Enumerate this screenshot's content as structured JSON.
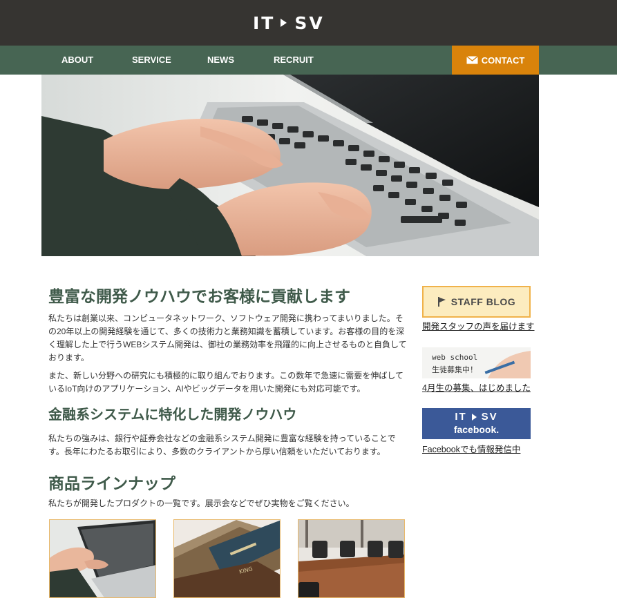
{
  "header": {
    "logo_left": "IT",
    "logo_right": "SV"
  },
  "nav": {
    "items": [
      {
        "label": "ABOUT"
      },
      {
        "label": "SERVICE"
      },
      {
        "label": "NEWS"
      },
      {
        "label": "RECRUIT"
      }
    ],
    "contact_label": "CONTACT"
  },
  "main": {
    "heading1": "豊富な開発ノウハウでお客様に貢献します",
    "para1": "私たちは創業以来、コンピュータネットワーク、ソフトウェア開発に携わってまいりました。その20年以上の開発経験を通じて、多くの技術力と業務知識を蓄積しています。お客様の目的を深く理解した上で行うWEBシステム開発は、御社の業務効率を飛躍的に向上させるものと自負しております。",
    "para2": "また、新しい分野への研究にも積極的に取り組んでおります。この数年で急速に需要を伸ばしているIoT向けのアプリケーション、AIやビッグデータを用いた開発にも対応可能です。",
    "heading2": "金融系システムに特化した開発ノウハウ",
    "para3": "私たちの強みは、銀行や証券会社などの金融系システム開発に豊富な経験を持っていることです。長年にわたるお取引により、多数のクライアントから厚い信頼をいただいております。",
    "heading3": "商品ラインナップ",
    "para4": "私たちが開発したプロダクトの一覧です。展示会などでぜひ実物をご覧ください。"
  },
  "sidebar": {
    "blog_banner": "STAFF BLOG",
    "blog_link": "開発スタッフの声を届けます",
    "school_line1": "web school",
    "school_line2": "生徒募集中！",
    "school_link": "4月生の募集、はじめました",
    "fb_logo_left": "IT",
    "fb_logo_right": "SV",
    "fb_word": "facebook.",
    "fb_link": "Facebookでも情報発信中"
  },
  "colors": {
    "topbar": "#363431",
    "nav": "#476553",
    "contact": "#d9830b",
    "heading": "#3f5a4a",
    "facebook": "#3b5998"
  },
  "icons": {
    "contact": "envelope-icon",
    "blog": "flag-icon",
    "logo_separator": "play-triangle-icon"
  }
}
